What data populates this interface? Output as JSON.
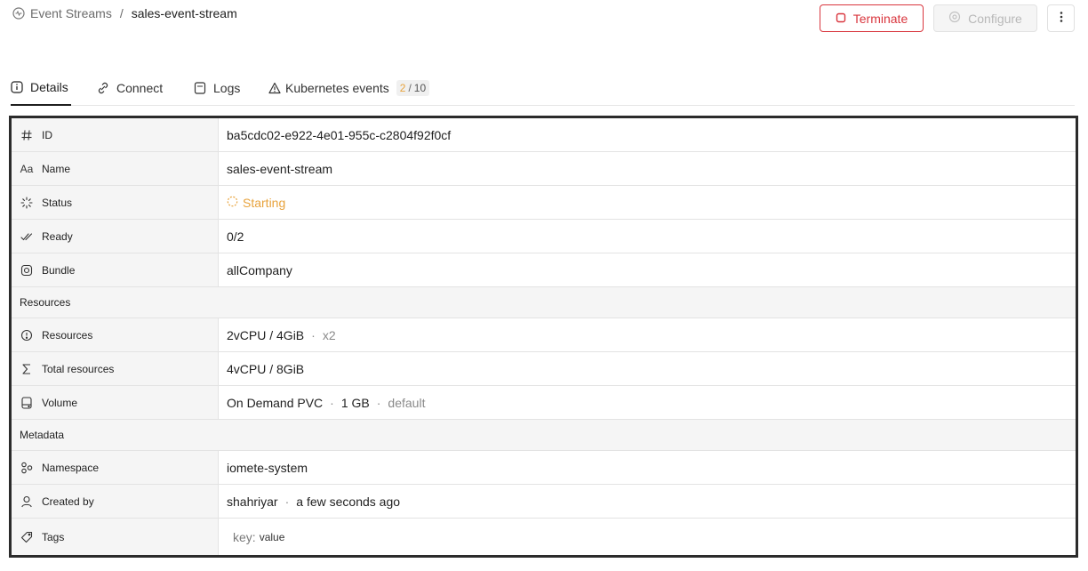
{
  "breadcrumb": {
    "parent": "Event Streams",
    "separator": "/",
    "current": "sales-event-stream"
  },
  "actions": {
    "terminate_label": "Terminate",
    "configure_label": "Configure",
    "more_icon": "more-vertical-icon"
  },
  "tabs": [
    {
      "label": "Details",
      "icon": "info-icon",
      "active": true
    },
    {
      "label": "Connect",
      "icon": "link-icon",
      "active": false
    },
    {
      "label": "Logs",
      "icon": "log-icon",
      "active": false
    },
    {
      "label": "Kubernetes events",
      "icon": "warning-icon",
      "active": false,
      "badge_warnings": "2",
      "badge_total": "10"
    }
  ],
  "details": {
    "id_label": "ID",
    "id_value": "ba5cdc02-e922-4e01-955c-c2804f92f0cf",
    "name_label": "Name",
    "name_value": "sales-event-stream",
    "status_label": "Status",
    "status_value": "Starting",
    "ready_label": "Ready",
    "ready_value": "0/2",
    "bundle_label": "Bundle",
    "bundle_value": "allCompany"
  },
  "resources_section": {
    "title": "Resources",
    "resources_label": "Resources",
    "resources_value": "2vCPU / 4GiB",
    "resources_multiplier": "x2",
    "total_label": "Total resources",
    "total_value": "4vCPU / 8GiB",
    "volume_label": "Volume",
    "volume_type": "On Demand PVC",
    "volume_size": "1 GB",
    "volume_class": "default"
  },
  "metadata_section": {
    "title": "Metadata",
    "namespace_label": "Namespace",
    "namespace_value": "iomete-system",
    "created_label": "Created by",
    "created_user": "shahriyar",
    "created_time": "a few seconds ago",
    "tags_label": "Tags",
    "tag_key_placeholder": "key:",
    "tag_value_placeholder": "value"
  },
  "colors": {
    "danger": "#d9363e",
    "warning": "#e8a33d",
    "disabled": "#b8b8b8"
  }
}
